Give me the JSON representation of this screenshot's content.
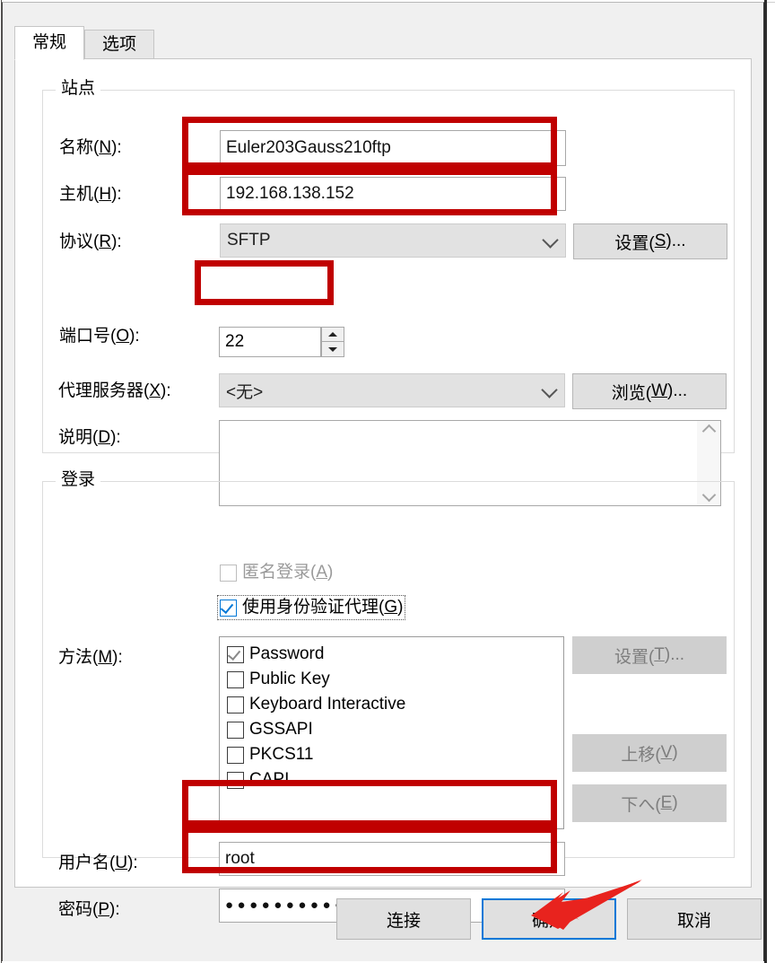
{
  "dialog": {
    "tabs": [
      {
        "label": "常规",
        "active": true
      },
      {
        "label": "选项",
        "active": false
      }
    ]
  },
  "site_group": {
    "legend": "站点",
    "name": {
      "label_prefix": "名称(",
      "label_accel": "N",
      "label_suffix": "):",
      "value": "Euler203Gauss210ftp"
    },
    "host": {
      "label_prefix": "主机(",
      "label_accel": "H",
      "label_suffix": "):",
      "value": "192.168.138.152"
    },
    "protocol": {
      "label_prefix": "协议(",
      "label_accel": "R",
      "label_suffix": "):",
      "value": "SFTP",
      "settings_button": {
        "prefix": "设置(",
        "accel": "S",
        "suffix": ")..."
      }
    },
    "port": {
      "label_prefix": "端口号(",
      "label_accel": "O",
      "label_suffix": "):",
      "value": "22"
    },
    "proxy": {
      "label_prefix": "代理服务器(",
      "label_accel": "X",
      "label_suffix": "):",
      "value": "<无>",
      "browse_button": {
        "prefix": "浏览(",
        "accel": "W",
        "suffix": ")..."
      }
    },
    "description": {
      "label_prefix": "说明(",
      "label_accel": "D",
      "label_suffix": "):",
      "value": ""
    }
  },
  "login_group": {
    "legend": "登录",
    "anonymous": {
      "label_prefix": "匿名登录(",
      "label_accel": "A",
      "label_suffix": ")",
      "checked": false,
      "enabled": false
    },
    "use_auth_agent": {
      "label_prefix": "使用身份验证代理(",
      "label_accel": "G",
      "label_suffix": ")",
      "checked": true,
      "focused": true
    },
    "method": {
      "label_prefix": "方法(",
      "label_accel": "M",
      "label_suffix": "):",
      "items": [
        {
          "label": "Password",
          "checked": true
        },
        {
          "label": "Public Key",
          "checked": false
        },
        {
          "label": "Keyboard Interactive",
          "checked": false
        },
        {
          "label": "GSSAPI",
          "checked": false
        },
        {
          "label": "PKCS11",
          "checked": false
        },
        {
          "label": "CAPI",
          "checked": false
        }
      ],
      "buttons": [
        {
          "prefix": "设置(",
          "accel": "T",
          "suffix": ")...",
          "disabled": true
        },
        {
          "prefix": "上移(",
          "accel": "V",
          "suffix": ")",
          "disabled": true
        },
        {
          "prefix": "下へ(",
          "accel": "E",
          "suffix": ")",
          "disabled": true
        }
      ]
    },
    "username": {
      "label_prefix": "用户名(",
      "label_accel": "U",
      "label_suffix": "):",
      "value": "root"
    },
    "password": {
      "label_prefix": "密码(",
      "label_accel": "P",
      "label_suffix": "):",
      "masked_value": "●●●●●●●●●●●●●",
      "char_count": 13
    }
  },
  "footer": {
    "connect_label": "连接",
    "ok_label": "确定",
    "cancel_label": "取消"
  },
  "annotations": {
    "highlight_color": "#c00000",
    "arrow_color": "#e8231e",
    "focus_color": "#0078d7",
    "highlighted_fields": [
      "name",
      "host",
      "port",
      "username",
      "password"
    ],
    "arrow_points_to": "确定"
  }
}
